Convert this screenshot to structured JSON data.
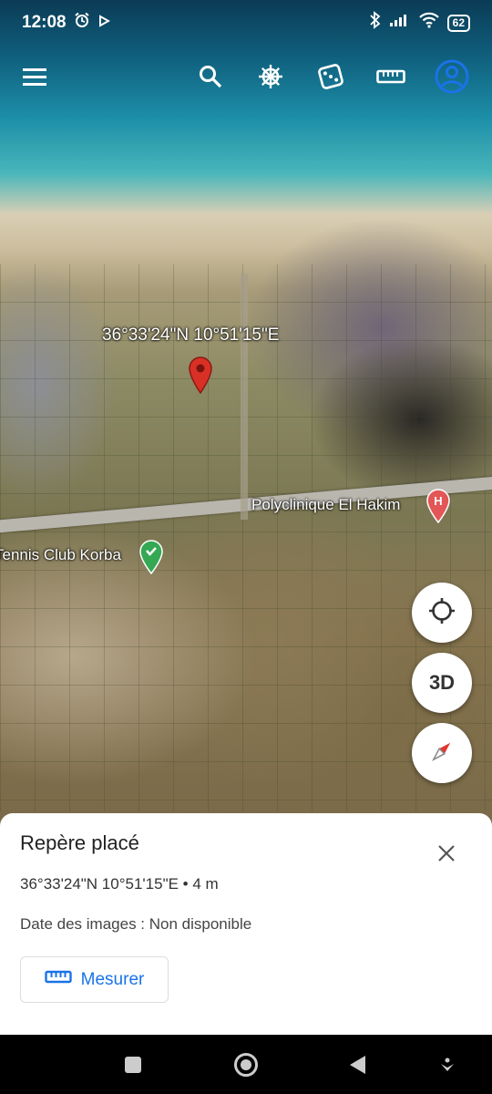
{
  "statusbar": {
    "time": "12:08",
    "battery": "62",
    "icons": [
      "alarm-icon",
      "play-icon",
      "bluetooth-icon",
      "signal-icon",
      "wifi-icon",
      "battery-icon"
    ]
  },
  "toolbar": {
    "icons": [
      "menu-icon",
      "search-icon",
      "voyager-wheel-icon",
      "feeling-lucky-dice-icon",
      "measure-ruler-icon",
      "account-icon"
    ],
    "accent_color": "#1a73e8"
  },
  "map": {
    "placemark_coords": "36°33'24\"N 10°51'15\"E",
    "poi": [
      {
        "label": "Polyclinique El Hakim",
        "icon": "hospital-pin-icon",
        "color": "#e35656"
      },
      {
        "label": "Tennis Club Korba",
        "icon": "place-pin-icon",
        "color": "#34a853"
      }
    ],
    "controls": {
      "locate_icon": "my-location-icon",
      "three_d": "3D",
      "compass_icon": "compass-icon"
    }
  },
  "sheet": {
    "title": "Repère placé",
    "coords": "36°33'24\"N 10°51'15\"E • 4 m",
    "date": "Date des images : Non disponible",
    "measure_label": "Mesurer",
    "close_icon": "close-icon"
  },
  "navbar": {
    "icons": [
      "recents-square-icon",
      "home-circle-icon",
      "back-triangle-icon",
      "assistant-icon"
    ]
  }
}
